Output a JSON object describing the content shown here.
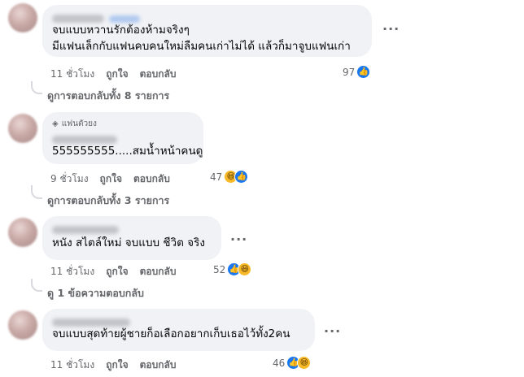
{
  "comments": [
    {
      "text_lines": [
        "จบแบบหวานรักต้องห้ามจริงๆ",
        "มีแฟนเล็กกับแฟนคบคนใหม่ลืมคนเก่าไม่ได้ แล้วก็มาจูบแฟนเก่า"
      ],
      "time": "11 ชั่วโมง",
      "like_label": "ถูกใจ",
      "reply_label": "ตอบกลับ",
      "reaction_count": "97",
      "reactions": [
        "like"
      ],
      "view_replies": "ดูการตอบกลับทั้ง 8 รายการ"
    },
    {
      "badge": "แฟนตัวยง",
      "text_lines": [
        "555555555.....สมน้ำหน้าคนดู"
      ],
      "time": "9 ชั่วโมง",
      "like_label": "ถูกใจ",
      "reply_label": "ตอบกลับ",
      "reaction_count": "47",
      "reactions": [
        "haha",
        "like"
      ],
      "view_replies": "ดูการตอบกลับทั้ง 3 รายการ"
    },
    {
      "text_lines": [
        "หนัง สไตล์ใหม่ จบแบบ ชีวิต จริง"
      ],
      "time": "11 ชั่วโมง",
      "like_label": "ถูกใจ",
      "reply_label": "ตอบกลับ",
      "reaction_count": "52",
      "reactions": [
        "like",
        "haha"
      ],
      "view_replies": "ดู 1 ข้อความตอบกลับ"
    },
    {
      "text_lines": [
        "จบแบบสุดท้ายผู้ชายก็อเลือกอยากเก็บเธอไว้ทั้ง2คน"
      ],
      "time": "11 ชั่วโมง",
      "like_label": "ถูกใจ",
      "reply_label": "ตอบกลับ",
      "reaction_count": "46",
      "reactions": [
        "like",
        "haha"
      ]
    }
  ],
  "more_glyph": "···",
  "icons": {
    "like": "thumbs-up-icon",
    "haha": "laughing-face-icon",
    "more": "more-options-icon",
    "badge": "diamond-icon"
  },
  "colors": {
    "bubble": "#f0f2f5",
    "meta_text": "#65676b",
    "like_blue": "#1877f2",
    "haha_yellow": "#f7b928"
  }
}
